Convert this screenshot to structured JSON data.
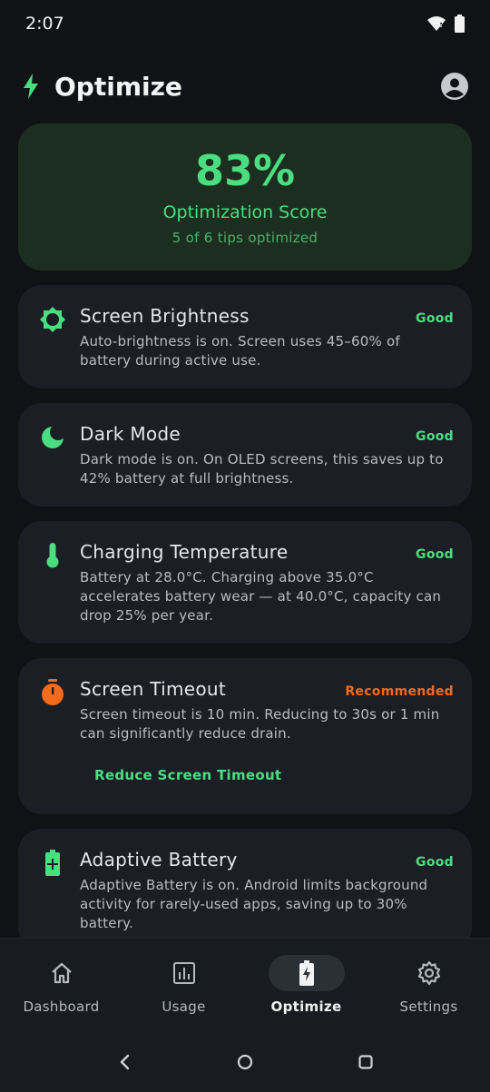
{
  "status_bar": {
    "time": "2:07"
  },
  "header": {
    "title": "Optimize"
  },
  "score": {
    "value": "83%",
    "label": "Optimization Score",
    "subtitle": "5 of 6 tips optimized"
  },
  "tips": [
    {
      "title": "Screen Brightness",
      "status": "Good",
      "desc": "Auto-brightness is on. Screen uses 45–60% of battery during active use.",
      "icon": "brightness-icon"
    },
    {
      "title": "Dark Mode",
      "status": "Good",
      "desc": "Dark mode is on. On OLED screens, this saves up to 42% battery at full brightness.",
      "icon": "moon-icon"
    },
    {
      "title": "Charging Temperature",
      "status": "Good",
      "desc": "Battery at 28.0°C. Charging above 35.0°C accelerates battery wear — at 40.0°C, capacity can drop 25% per year.",
      "icon": "thermometer-icon"
    },
    {
      "title": "Screen Timeout",
      "status": "Recommended",
      "desc": "Screen timeout is 10 min. Reducing to 30s or 1 min can significantly reduce drain.",
      "action": "Reduce Screen Timeout",
      "icon": "timer-icon"
    },
    {
      "title": "Adaptive Battery",
      "status": "Good",
      "desc": "Adaptive Battery is on. Android limits background activity for rarely-used apps, saving up to 30% battery.",
      "icon": "battery-plus-icon"
    }
  ],
  "nav": [
    {
      "label": "Dashboard",
      "icon": "home-icon"
    },
    {
      "label": "Usage",
      "icon": "bar-chart-icon"
    },
    {
      "label": "Optimize",
      "icon": "battery-bolt-icon",
      "active": true
    },
    {
      "label": "Settings",
      "icon": "gear-icon"
    }
  ],
  "colors": {
    "accent": "#4ade80",
    "warning": "#f26b1d",
    "background": "#101216",
    "card": "#1b1e24"
  }
}
